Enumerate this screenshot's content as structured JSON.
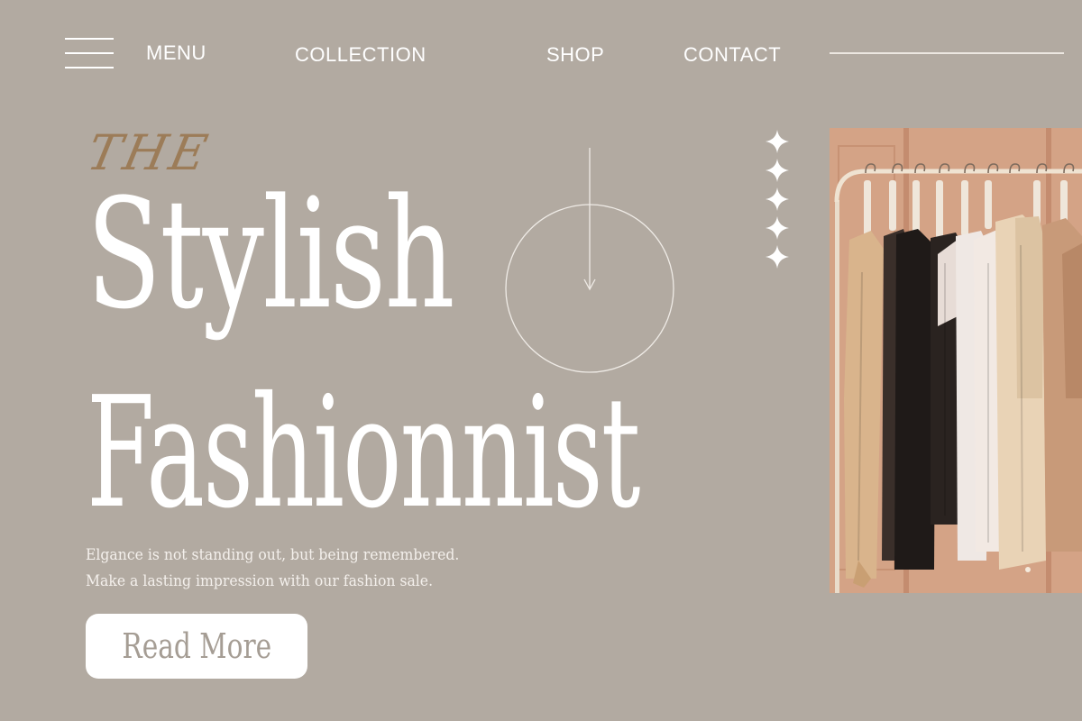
{
  "nav": {
    "menu_label": "MENU",
    "links": [
      "COLLECTION",
      "SHOP",
      "CONTACT"
    ]
  },
  "hero": {
    "eyebrow": "THE",
    "title_line_1": "Stylish",
    "title_line_2": "Fashionnist",
    "tagline": "Elgance is not standing out, but being remembered. Make a lasting impression with our fashion sale.",
    "cta_label": "Read More"
  },
  "icons": {
    "menu": "hamburger-icon",
    "scroll": "arrow-down-circle-icon",
    "decor": "sparkle-stars-icon"
  },
  "image": {
    "subject": "clothing rack photo"
  },
  "colors": {
    "background": "#b2aaa1",
    "text": "#ffffff",
    "accent_script": "#9c7c58",
    "button_bg": "#ffffff",
    "button_text": "#a59d94",
    "photo_wall": "#d7a689"
  }
}
